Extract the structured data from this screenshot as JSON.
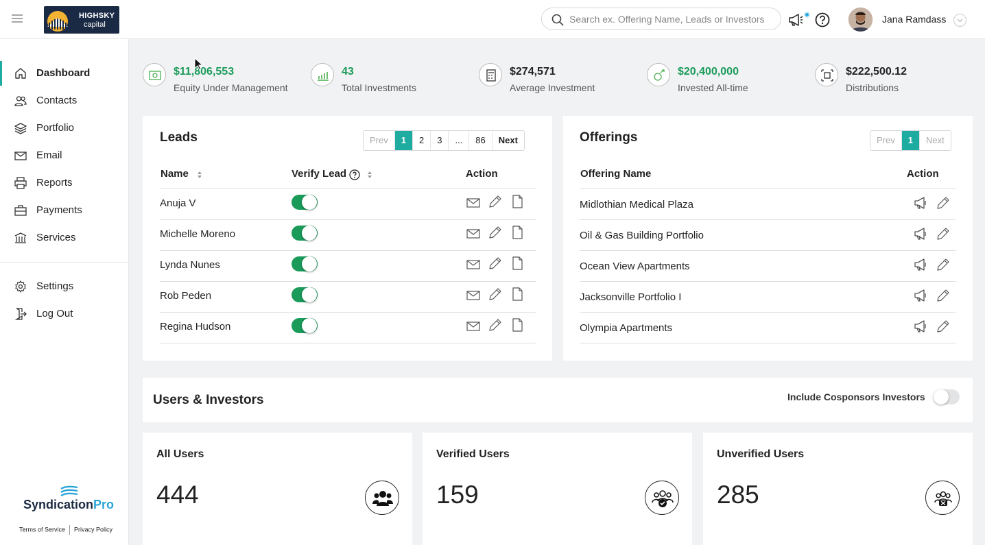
{
  "header": {
    "brand_name": "HIGHSKY",
    "brand_sub": "capital",
    "search_placeholder": "Search ex. Offering Name, Leads or Investors",
    "user_name": "Jana Ramdass"
  },
  "sidebar": {
    "items": [
      {
        "label": "Dashboard",
        "icon": "home-icon"
      },
      {
        "label": "Contacts",
        "icon": "users-icon"
      },
      {
        "label": "Portfolio",
        "icon": "layers-icon"
      },
      {
        "label": "Email",
        "icon": "mail-icon"
      },
      {
        "label": "Reports",
        "icon": "printer-icon"
      },
      {
        "label": "Payments",
        "icon": "briefcase-icon"
      },
      {
        "label": "Services",
        "icon": "building-icon"
      },
      {
        "label": "Settings",
        "icon": "gear-icon"
      },
      {
        "label": "Log Out",
        "icon": "logout-icon"
      }
    ],
    "powered_by_a": "Syndication",
    "powered_by_b": "Pro",
    "terms": "Terms of Service",
    "privacy": "Privacy Policy"
  },
  "stats": [
    {
      "value": "$11,806,553",
      "label": "Equity Under Management",
      "color": "#1a9b5a"
    },
    {
      "value": "43",
      "label": "Total Investments",
      "color": "#1a9b5a"
    },
    {
      "value": "$274,571",
      "label": "Average Investment",
      "color": "#222222"
    },
    {
      "value": "$20,400,000",
      "label": "Invested All-time",
      "color": "#1a9b5a"
    },
    {
      "value": "$222,500.12",
      "label": "Distributions",
      "color": "#222222"
    }
  ],
  "leads": {
    "title": "Leads",
    "pager": {
      "prev": "Prev",
      "pages": [
        "1",
        "2",
        "3",
        "...",
        "86"
      ],
      "next": "Next",
      "current": "1"
    },
    "columns": {
      "name": "Name",
      "verify": "Verify Lead",
      "action": "Action"
    },
    "rows": [
      {
        "name": "Anuja V",
        "verified": true
      },
      {
        "name": "Michelle Moreno",
        "verified": true
      },
      {
        "name": "Lynda Nunes",
        "verified": true
      },
      {
        "name": "Rob Peden",
        "verified": true
      },
      {
        "name": "Regina Hudson",
        "verified": true
      }
    ]
  },
  "offerings": {
    "title": "Offerings",
    "pager": {
      "prev": "Prev",
      "pages": [
        "1"
      ],
      "next": "Next",
      "current": "1"
    },
    "columns": {
      "name": "Offering Name",
      "action": "Action"
    },
    "rows": [
      {
        "name": "Midlothian Medical Plaza"
      },
      {
        "name": "Oil & Gas Building Portfolio"
      },
      {
        "name": "Ocean View Apartments"
      },
      {
        "name": "Jacksonville Portfolio I"
      },
      {
        "name": "Olympia Apartments"
      }
    ]
  },
  "users_investors": {
    "title": "Users & Investors",
    "cosponsor_label": "Include Cosponsors Investors",
    "cosponsor_on": false,
    "cards": [
      {
        "title": "All Users",
        "count": "444",
        "icon": "users-group-icon"
      },
      {
        "title": "Verified Users",
        "count": "159",
        "icon": "verified-users-icon"
      },
      {
        "title": "Unverified Users",
        "count": "285",
        "icon": "unverified-users-icon"
      }
    ]
  },
  "colors": {
    "accent": "#1eaba0",
    "positive": "#1a9b5a",
    "brand_dark": "#1b2a44"
  }
}
